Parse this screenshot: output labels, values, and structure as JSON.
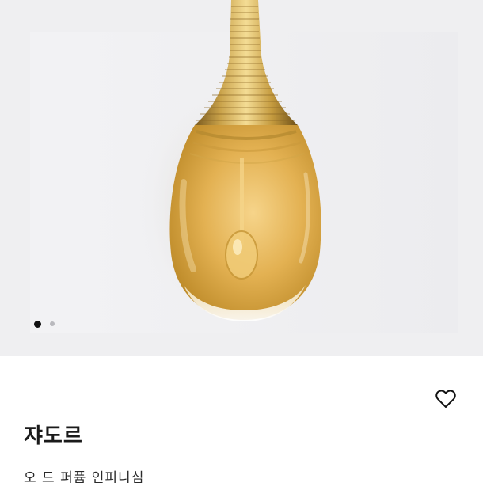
{
  "product": {
    "name": "쟈도르",
    "subtitle": "오 드 퍼퓸 인피니심"
  },
  "gallery": {
    "total_images": 2,
    "active_index": 0
  },
  "icons": {
    "wish": "heart-outline-icon"
  },
  "colors": {
    "gallery_background": "#efeff1",
    "dot_active": "#111111",
    "dot_inactive": "#b9b9bd",
    "gold": "#c9a24a",
    "liquid": "#e6b85a"
  }
}
